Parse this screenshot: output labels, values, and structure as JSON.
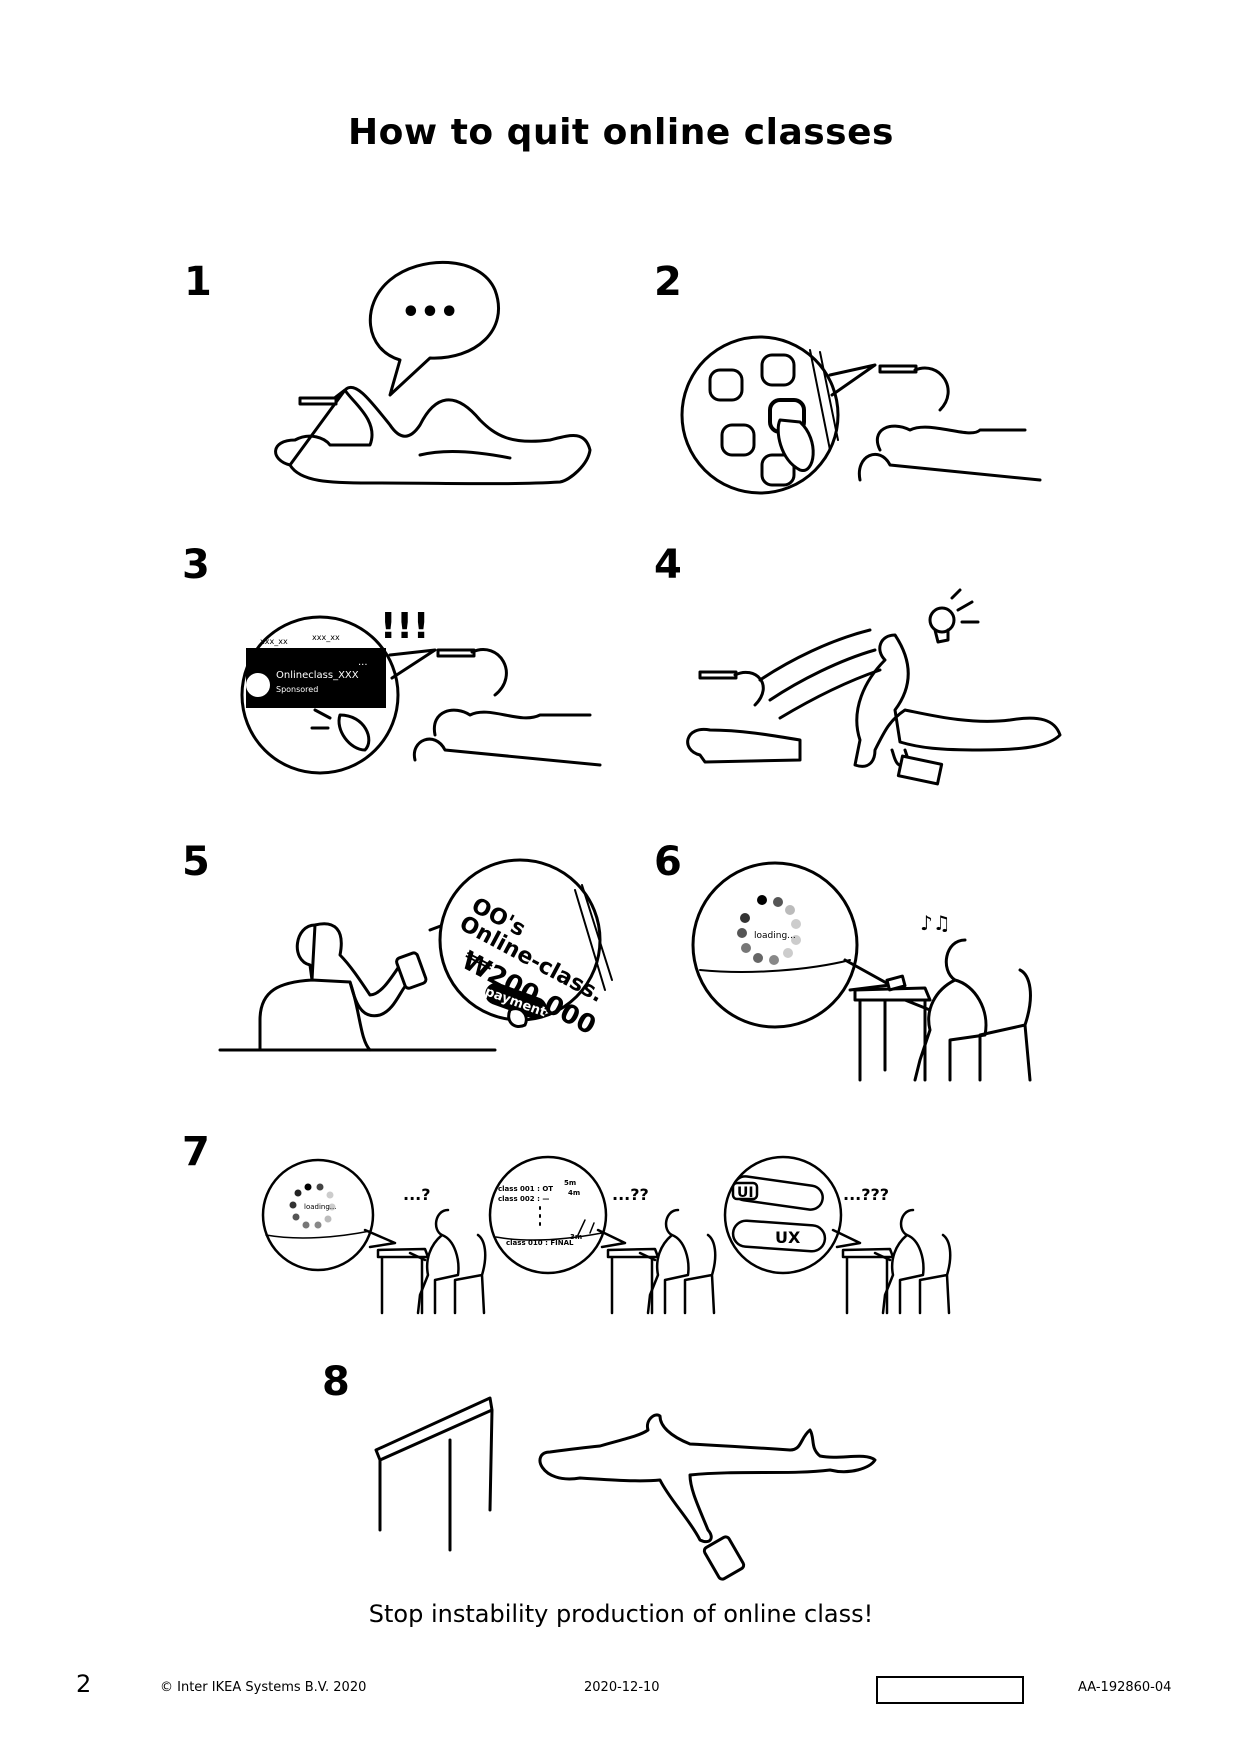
{
  "title": "How to quit online classes",
  "steps": [
    {
      "number": "1",
      "bubble_text": "•••"
    },
    {
      "number": "2"
    },
    {
      "number": "3",
      "exclaim": "!!!",
      "ad_name": "Onlineclass_XXX",
      "ad_sub": "Sponsored",
      "tag_left": "xxx_xx",
      "tag_right": "xxx_xx",
      "more": "..."
    },
    {
      "number": "4"
    },
    {
      "number": "5",
      "line1": "OO's",
      "line2": "Online-class.",
      "price": "₩200,000",
      "pay_button": "payment"
    },
    {
      "number": "6",
      "loading": "loading..."
    },
    {
      "number": "7",
      "panel_a": {
        "loading": "loading...",
        "reaction": "...?"
      },
      "panel_b": {
        "row1_class": "class 001 : OT",
        "row1_time": "5m",
        "row2_class": "class 002 : —",
        "row2_time": "4m",
        "row3_class": "class 010 : FINAL",
        "row3_time": "3m",
        "reaction": "...??"
      },
      "panel_c": {
        "ui": "UI",
        "ux": "UX",
        "reaction": "...???"
      }
    },
    {
      "number": "8"
    }
  ],
  "caption": "Stop instability production of online class!",
  "footer": {
    "page_number": "2",
    "copyright": "© Inter IKEA Systems B.V. 2020",
    "date": "2020-12-10",
    "doc_id": "AA-192860-04"
  }
}
